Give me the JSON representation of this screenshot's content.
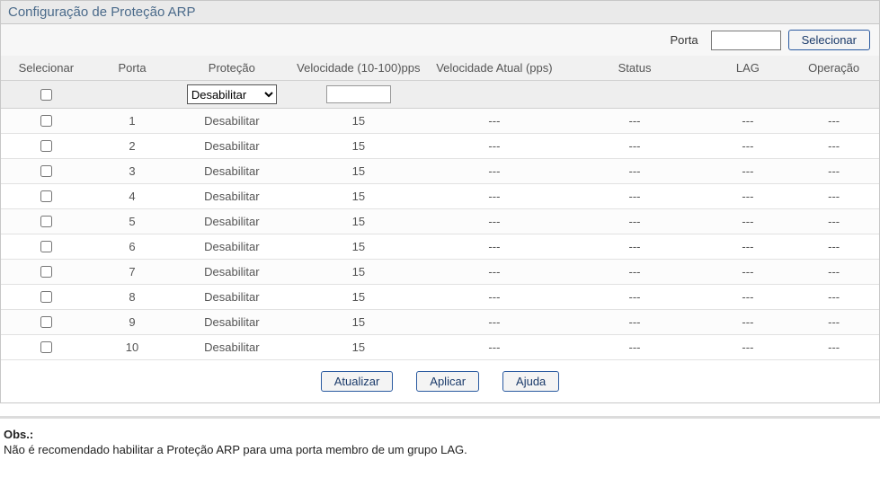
{
  "panel": {
    "title": "Configuração de Proteção ARP"
  },
  "topbar": {
    "porta_label": "Porta",
    "porta_value": "",
    "select_btn": "Selecionar"
  },
  "headers": {
    "select": "Selecionar",
    "port": "Porta",
    "protection": "Proteção",
    "speed": "Velocidade (10-100)pps",
    "cur_speed": "Velocidade Atual (pps)",
    "status": "Status",
    "lag": "LAG",
    "operation": "Operação"
  },
  "control_row": {
    "proto_options": [
      "Desabilitar"
    ],
    "proto_selected": "Desabilitar",
    "speed_value": ""
  },
  "rows": [
    {
      "port": "1",
      "protection": "Desabilitar",
      "speed": "15",
      "cur": "---",
      "status": "---",
      "lag": "---",
      "op": "---"
    },
    {
      "port": "2",
      "protection": "Desabilitar",
      "speed": "15",
      "cur": "---",
      "status": "---",
      "lag": "---",
      "op": "---"
    },
    {
      "port": "3",
      "protection": "Desabilitar",
      "speed": "15",
      "cur": "---",
      "status": "---",
      "lag": "---",
      "op": "---"
    },
    {
      "port": "4",
      "protection": "Desabilitar",
      "speed": "15",
      "cur": "---",
      "status": "---",
      "lag": "---",
      "op": "---"
    },
    {
      "port": "5",
      "protection": "Desabilitar",
      "speed": "15",
      "cur": "---",
      "status": "---",
      "lag": "---",
      "op": "---"
    },
    {
      "port": "6",
      "protection": "Desabilitar",
      "speed": "15",
      "cur": "---",
      "status": "---",
      "lag": "---",
      "op": "---"
    },
    {
      "port": "7",
      "protection": "Desabilitar",
      "speed": "15",
      "cur": "---",
      "status": "---",
      "lag": "---",
      "op": "---"
    },
    {
      "port": "8",
      "protection": "Desabilitar",
      "speed": "15",
      "cur": "---",
      "status": "---",
      "lag": "---",
      "op": "---"
    },
    {
      "port": "9",
      "protection": "Desabilitar",
      "speed": "15",
      "cur": "---",
      "status": "---",
      "lag": "---",
      "op": "---"
    },
    {
      "port": "10",
      "protection": "Desabilitar",
      "speed": "15",
      "cur": "---",
      "status": "---",
      "lag": "---",
      "op": "---"
    }
  ],
  "actions": {
    "refresh": "Atualizar",
    "apply": "Aplicar",
    "help": "Ajuda"
  },
  "note": {
    "title": "Obs.:",
    "body": "Não é recomendado habilitar a Proteção ARP para uma porta membro de um grupo LAG."
  }
}
